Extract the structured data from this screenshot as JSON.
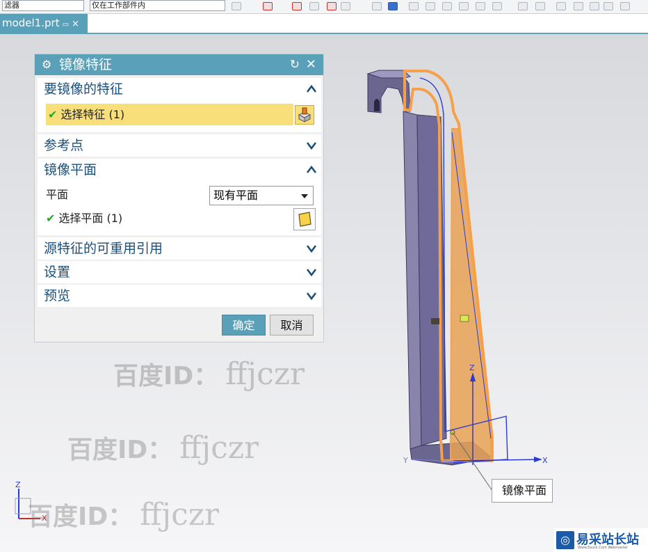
{
  "toolbar": {
    "filter_text": "滤器",
    "scope_text": "仅在工作部件内"
  },
  "tabs": [
    {
      "label": "model1.prt",
      "close": "×"
    }
  ],
  "dialog": {
    "title": "镜像特征",
    "sections": {
      "features": {
        "label": "要镜像的特征",
        "select_row": "选择特征 (1)"
      },
      "ref_point": {
        "label": "参考点"
      },
      "mirror_plane": {
        "label": "镜像平面",
        "plane_label": "平面",
        "plane_value": "现有平面",
        "select_row": "选择平面 (1)"
      },
      "reusable_refs": {
        "label": "源特征的可重用引用"
      },
      "settings": {
        "label": "设置"
      },
      "preview": {
        "label": "预览"
      }
    },
    "ok": "确定",
    "cancel": "取消"
  },
  "viewport": {
    "axis_labels": {
      "z": "Z",
      "x": "X",
      "y": "Y"
    },
    "callout": "镜像平面",
    "colors": {
      "part": "#6b6690",
      "highlight": "#f6a04a",
      "plane": "#2a3ad0"
    }
  },
  "watermarks": [
    {
      "prefix": "百度ID：",
      "id": "ffjczr"
    },
    {
      "prefix": "百度ID：",
      "id": "ffjczr"
    },
    {
      "prefix": "百度ID：",
      "id": "ffjczr"
    }
  ],
  "brand": {
    "name": "易采站长站",
    "url": "Www.Easck.Com Webmaster"
  }
}
